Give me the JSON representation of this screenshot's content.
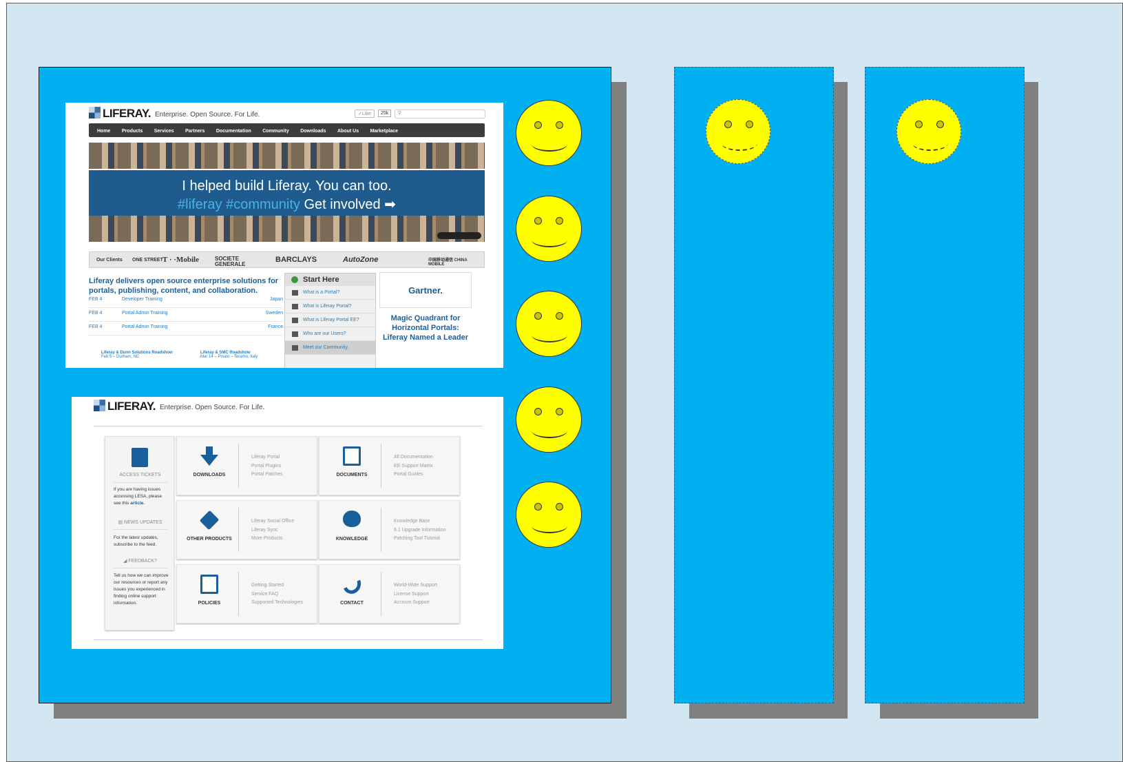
{
  "screenshot_1": {
    "logo": "LIFERAY.",
    "tagline": "Enterprise. Open Source. For Life.",
    "like_label": "✓Like",
    "like_count": "25k",
    "nav": [
      "Home",
      "Products",
      "Services",
      "Partners",
      "Documentation",
      "Community",
      "Downloads",
      "About Us",
      "Marketplace"
    ],
    "banner_line1": "I helped build Liferay. You can too.",
    "banner_hashtags": "#liferay #community",
    "banner_cta": "Get involved ➡",
    "clients_label": "Our Clients",
    "clients": [
      "ONE STREET",
      "T · ·Mobile",
      "SOCIETE GENERALE",
      "BARCLAYS",
      "AutoZone",
      "中国移动通信 CHINA MOBILE"
    ],
    "headline": "Liferay delivers open source enterprise solutions for portals, publishing, content, and collaboration.",
    "events": [
      {
        "date": "FEB 4",
        "title": "Developer Training",
        "place": "Japan"
      },
      {
        "date": "FEB 4",
        "title": "Portal Admin Training",
        "place": "Sweden"
      },
      {
        "date": "FEB 4",
        "title": "Portal Admin Training",
        "place": "France"
      }
    ],
    "roadshow_1": "Liferay & Dunn Solutions Roadshow",
    "roadshow_1_sub": "Feb 5 – Durham, NC",
    "roadshow_2": "Liferay & SMC Roadshow",
    "roadshow_2_sub": "Mar 14 – Pinato – Teramo, Italy",
    "start_here": {
      "title": "Start Here",
      "items": [
        "What is a Portal?",
        "What is Liferay Portal?",
        "What is Liferay Portal EE?",
        "Who are our Users?",
        "Meet our Community."
      ]
    },
    "gartner_logo": "Gartner.",
    "gartner_text": "Magic Quadrant for Horizontal Portals: Liferay Named a Leader"
  },
  "screenshot_2": {
    "logo": "LIFERAY.",
    "tagline": "Enterprise. Open Source. For Life.",
    "sidebar": {
      "access_title": "ACCESS TICKETS",
      "access_text": "If you are having issues accessing LESA, please see this",
      "access_link": "article.",
      "news_title": "NEWS UPDATES",
      "news_text": "For the latest updates, subscribe to the feed.",
      "feedback_title": "FEEDBACK?",
      "feedback_text": "Tell us how we can improve our resources or report any issues you experienced in finding online support information."
    },
    "cards": [
      {
        "name": "DOWNLOADS",
        "icon": "download-arrow-icon",
        "links": [
          "Liferay Portal",
          "Portal Plugins",
          "Portal Patches"
        ]
      },
      {
        "name": "DOCUMENTS",
        "icon": "documents-icon",
        "links": [
          "All Documentation",
          "EE Support Matrix",
          "Portal Guides"
        ]
      },
      {
        "name": "OTHER PRODUCTS",
        "icon": "cube-icon",
        "links": [
          "Liferay Social Office",
          "Liferay Sync",
          "More Products"
        ]
      },
      {
        "name": "KNOWLEDGE",
        "icon": "brain-icon",
        "links": [
          "Knowledge Base",
          "6.1 Upgrade Information",
          "Patching Tool Tutorial"
        ]
      },
      {
        "name": "POLICIES",
        "icon": "policies-icon",
        "links": [
          "Getting Started",
          "Service FAQ",
          "Supported Technologies"
        ]
      },
      {
        "name": "CONTACT",
        "icon": "phone-icon",
        "links": [
          "World-Wide Support",
          "License Support",
          "Account Support"
        ]
      }
    ]
  },
  "colors": {
    "slide_background": "#d3e6f2",
    "panel_fill": "#00b0f0",
    "panel_shadow": "#808080",
    "smiley_fill": "#ffff00",
    "liferay_blue": "#1a5f9c"
  }
}
